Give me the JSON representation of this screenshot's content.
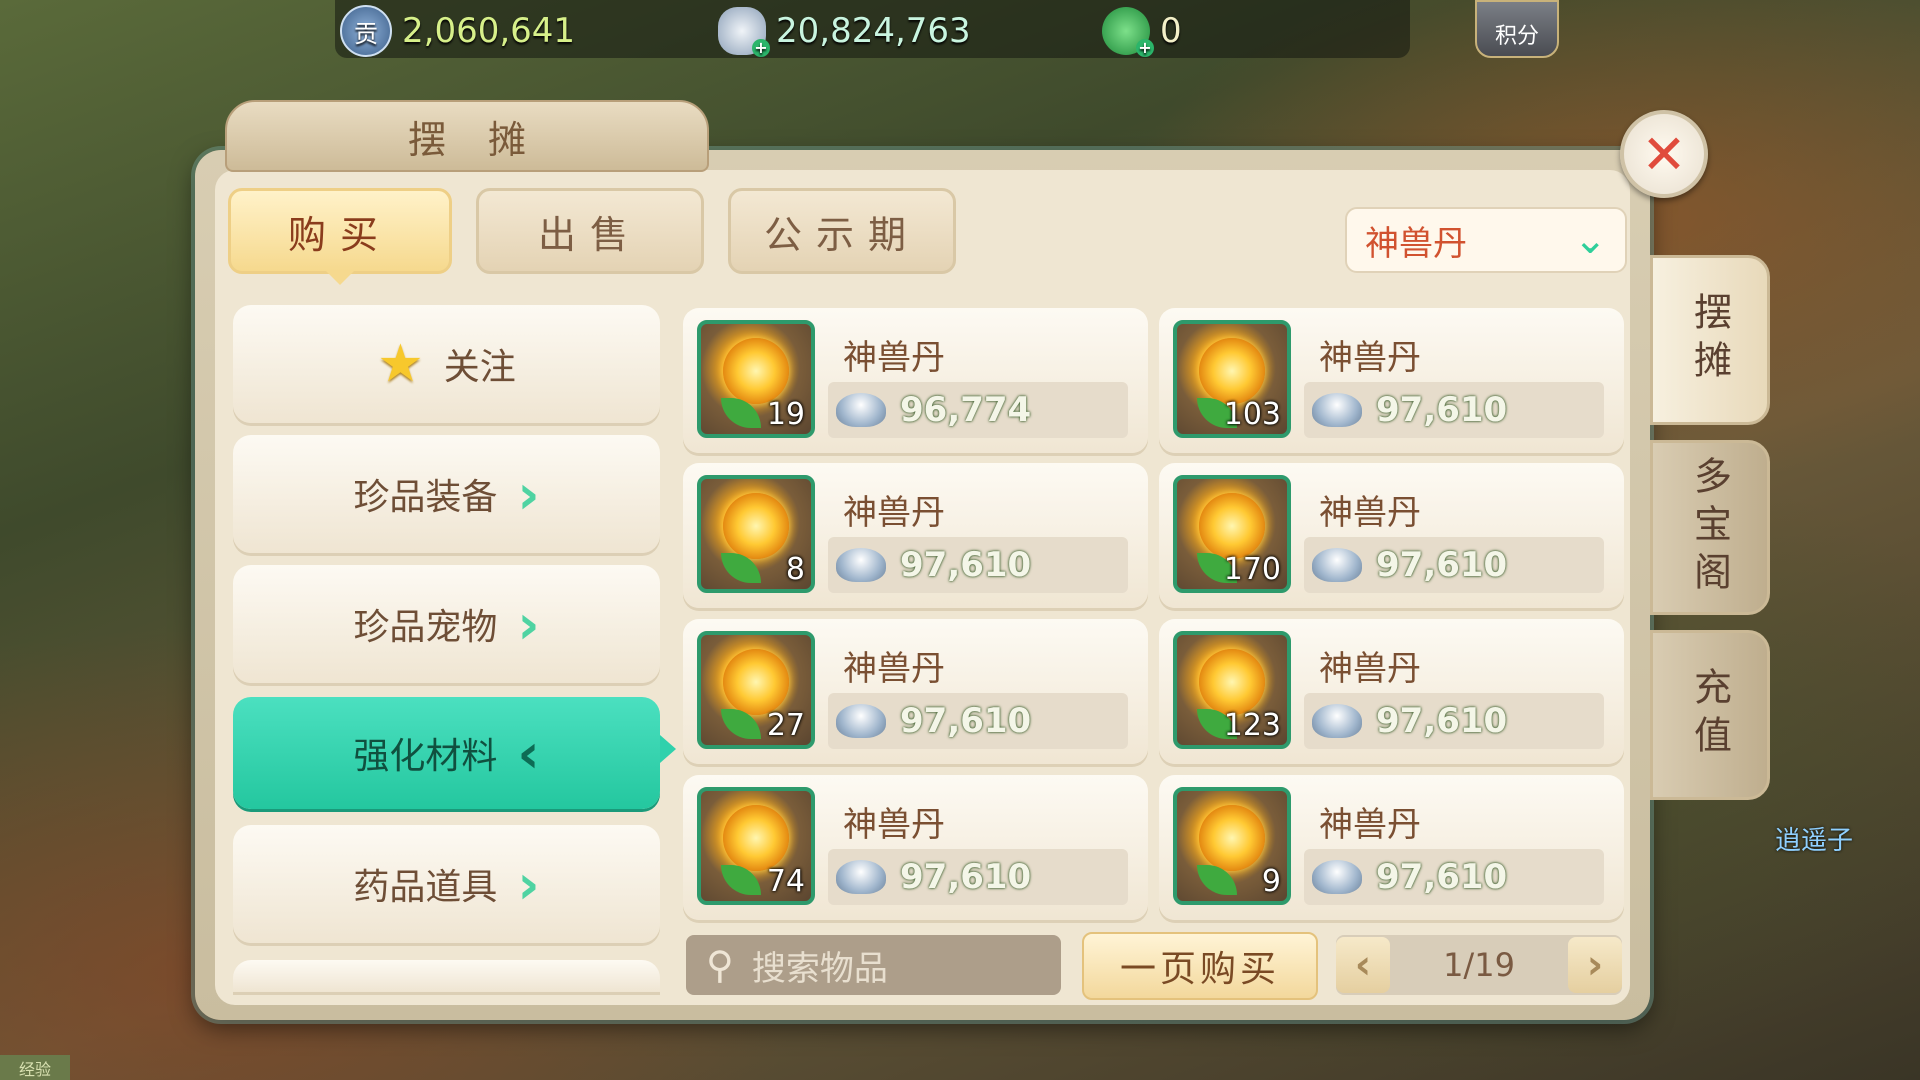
{
  "resources": [
    {
      "icon": "contribution-coin-icon",
      "glyph": "贡",
      "value": "2,060,641"
    },
    {
      "icon": "silver-ingot-icon",
      "glyph": "",
      "value": "20,824,763"
    },
    {
      "icon": "jade-icon",
      "glyph": "",
      "value": "0"
    }
  ],
  "score_button": "积分",
  "window_title": "摆摊",
  "tabs": [
    {
      "label": "购买",
      "active": true
    },
    {
      "label": "出售",
      "active": false
    },
    {
      "label": "公示期",
      "active": false
    }
  ],
  "filter_dropdown": {
    "value": "神兽丹"
  },
  "side_tabs": [
    "摆摊",
    "多宝阁",
    "充值"
  ],
  "categories": [
    {
      "label": "关注",
      "icon": "star-icon"
    },
    {
      "label": "珍品装备",
      "icon": "chevron-right-icon"
    },
    {
      "label": "珍品宠物",
      "icon": "chevron-right-icon"
    },
    {
      "label": "强化材料",
      "icon": "chevron-left-icon",
      "active": true
    },
    {
      "label": "药品道具",
      "icon": "chevron-right-icon"
    }
  ],
  "items": [
    {
      "name": "神兽丹",
      "qty": "19",
      "price": "96,774"
    },
    {
      "name": "神兽丹",
      "qty": "103",
      "price": "97,610"
    },
    {
      "name": "神兽丹",
      "qty": "8",
      "price": "97,610"
    },
    {
      "name": "神兽丹",
      "qty": "170",
      "price": "97,610"
    },
    {
      "name": "神兽丹",
      "qty": "27",
      "price": "97,610"
    },
    {
      "name": "神兽丹",
      "qty": "123",
      "price": "97,610"
    },
    {
      "name": "神兽丹",
      "qty": "74",
      "price": "97,610"
    },
    {
      "name": "神兽丹",
      "qty": "9",
      "price": "97,610"
    }
  ],
  "search": {
    "placeholder": "搜索物品"
  },
  "buy_page_button": "一页购买",
  "pager": {
    "current": "1/19",
    "prev_icon": "chevron-left-icon",
    "next_icon": "chevron-right-icon"
  },
  "npc_name": "逍遥子",
  "exp_label": "经验",
  "close_icon": "✕",
  "colors": {
    "accent": "#24c79f",
    "price_text": "#f4f6e8",
    "name_text": "#7a4f32",
    "dropdown_text": "#d1522f"
  }
}
